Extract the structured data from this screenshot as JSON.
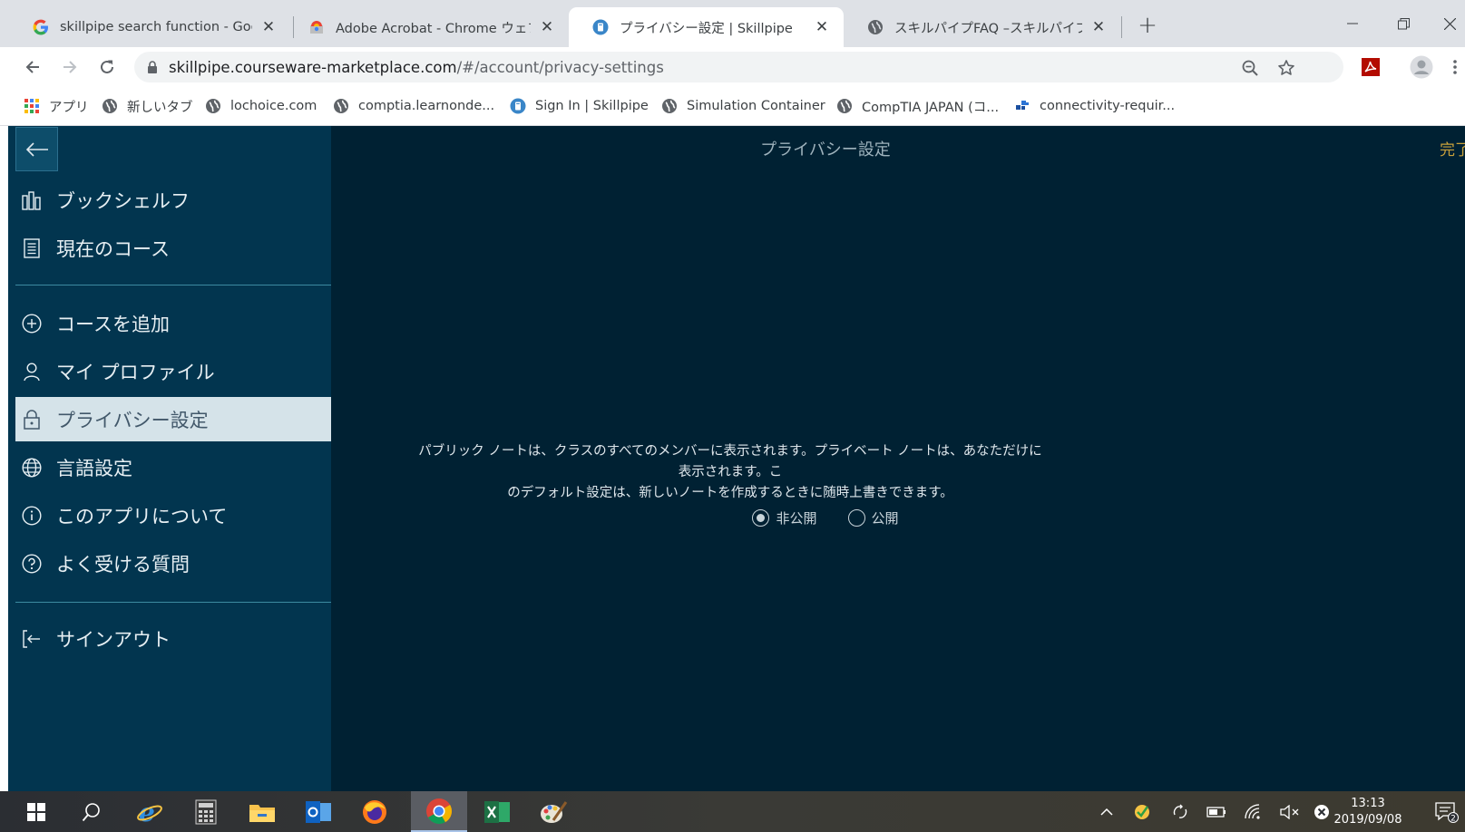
{
  "browser": {
    "tabs": [
      {
        "title": "skillpipe search function - Google",
        "favicon": "google-g-icon",
        "active": false
      },
      {
        "title": "Adobe Acrobat - Chrome ウェブスト",
        "favicon": "chrome-webstore-icon",
        "active": false
      },
      {
        "title": "プライバシー設定 | Skillpipe",
        "favicon": "skillpipe-icon",
        "active": true
      },
      {
        "title": "スキルパイプFAQ –スキルパイプ",
        "favicon": "globe-icon",
        "active": false
      }
    ],
    "url": {
      "host": "skillpipe.courseware-marketplace.com",
      "path": "/#/account/privacy-settings"
    },
    "bookmarks": [
      {
        "label": "アプリ",
        "icon": "apps-grid-icon"
      },
      {
        "label": "新しいタブ",
        "icon": "globe-icon"
      },
      {
        "label": "lochoice.com",
        "icon": "globe-icon"
      },
      {
        "label": "comptia.learnonde...",
        "icon": "globe-icon"
      },
      {
        "label": "Sign In | Skillpipe",
        "icon": "skillpipe-icon"
      },
      {
        "label": "Simulation Container",
        "icon": "globe-icon"
      },
      {
        "label": "CompTIA JAPAN (コ...",
        "icon": "globe-icon"
      },
      {
        "label": "connectivity-requir...",
        "icon": "blue-blocks-icon"
      }
    ]
  },
  "sidebar": {
    "groups": [
      [
        {
          "label": "ブックシェルフ",
          "icon": "bookshelf-icon"
        },
        {
          "label": "現在のコース",
          "icon": "document-icon"
        }
      ],
      [
        {
          "label": "コースを追加",
          "icon": "plus-circle-icon"
        },
        {
          "label": "マイ プロファイル",
          "icon": "user-icon"
        },
        {
          "label": "プライバシー設定",
          "icon": "lock-icon",
          "selected": true
        },
        {
          "label": "言語設定",
          "icon": "globe-icon"
        },
        {
          "label": "このアプリについて",
          "icon": "info-icon"
        },
        {
          "label": "よく受ける質問",
          "icon": "question-icon"
        }
      ],
      [
        {
          "label": "サインアウト",
          "icon": "sign-out-icon"
        }
      ]
    ]
  },
  "main": {
    "title": "プライバシー設定",
    "done_label": "完了",
    "description_line1": "パブリック ノートは、クラスのすべてのメンバーに表示されます。プライベート ノートは、あなただけに表示されます。こ",
    "description_line2": "のデフォルト設定は、新しいノートを作成するときに随時上書きできます。",
    "options": [
      {
        "label": "非公開",
        "selected": true
      },
      {
        "label": "公開",
        "selected": false
      }
    ]
  },
  "taskbar": {
    "clock_time": "13:13",
    "clock_date": "2019/09/08",
    "notification_count": "2"
  },
  "colors": {
    "sidebar_bg": "#02354f",
    "main_bg": "#002133",
    "selected_item_bg": "#d5e3e9",
    "done_accent": "#c9a13b"
  }
}
